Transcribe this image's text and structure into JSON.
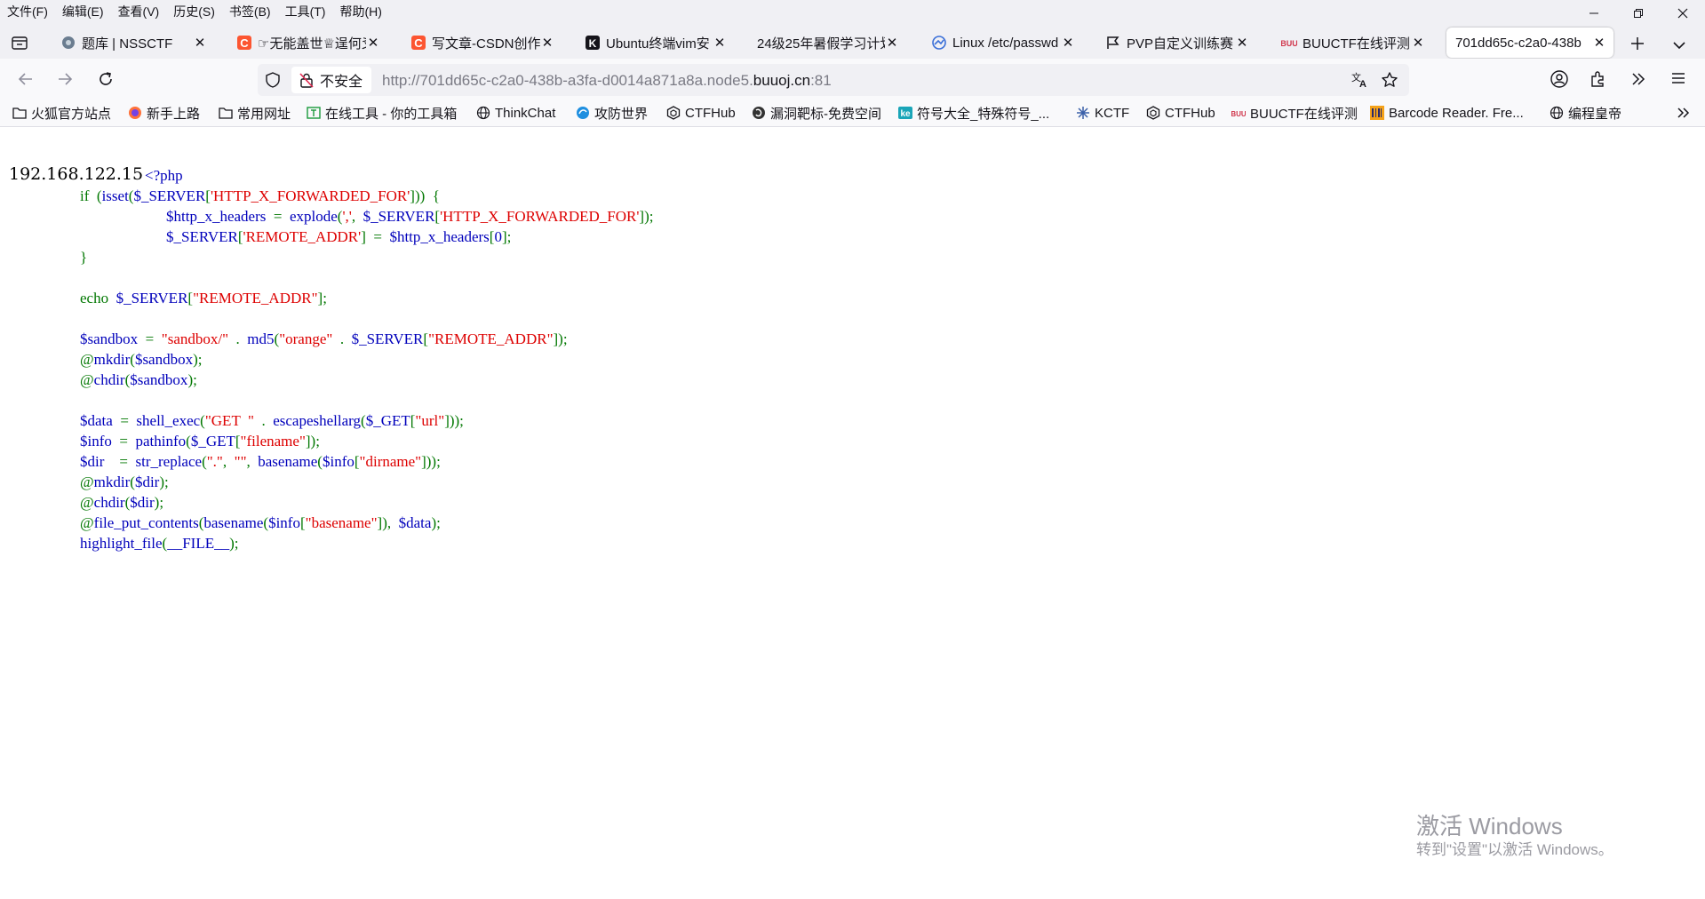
{
  "menu": [
    "文件(F)",
    "编辑(E)",
    "查看(V)",
    "历史(S)",
    "书签(B)",
    "工具(T)",
    "帮助(H)"
  ],
  "tabs": [
    {
      "title": "题库 | NSSCTF",
      "icon": "nssctf-icon"
    },
    {
      "title": "☞无能盖世♕逞何爻",
      "icon": "csdn-icon",
      "color": "#fc5531"
    },
    {
      "title": "写文章-CSDN创作",
      "icon": "csdn-icon",
      "color": "#fc5531"
    },
    {
      "title": "Ubuntu终端vim安",
      "icon": "k-icon"
    },
    {
      "title": "24级25年暑假学习计划",
      "icon": "none"
    },
    {
      "title": "Linux /etc/passwd",
      "icon": "globe-icon"
    },
    {
      "title": "PVP自定义训练赛",
      "icon": "flag-icon"
    },
    {
      "title": "BUUCTF在线评测",
      "icon": "buuctf-icon"
    },
    {
      "title": "701dd65c-c2a0-438b",
      "icon": "none",
      "active": true
    }
  ],
  "nav": {
    "insecure_label": "不安全",
    "url_prefix": "http://701dd65c-c2a0-438b-a3fa-d0014a871a8a.node5.",
    "url_host": "buuoj.cn",
    "url_suffix": ":81"
  },
  "bookmarks": [
    {
      "label": "火狐官方站点",
      "icon": "folder-icon"
    },
    {
      "label": "新手上路",
      "icon": "firefox-icon"
    },
    {
      "label": "常用网址",
      "icon": "folder-icon"
    },
    {
      "label": "在线工具 - 你的工具箱",
      "icon": "tools-icon"
    },
    {
      "label": "ThinkChat",
      "icon": "globe-icon"
    },
    {
      "label": "攻防世界",
      "icon": "adworld-icon"
    },
    {
      "label": "CTFHub",
      "icon": "ctfhub-icon"
    },
    {
      "label": "漏洞靶标-免费空间",
      "icon": "vulnbox-icon"
    },
    {
      "label": "符号大全_特殊符号_...",
      "icon": "ke-icon"
    },
    {
      "label": "KCTF",
      "icon": "kctf-icon"
    },
    {
      "label": "CTFHub",
      "icon": "ctfhub-icon"
    },
    {
      "label": "BUUCTF在线评测",
      "icon": "buuctf-icon"
    },
    {
      "label": "Barcode Reader. Fre...",
      "icon": "barcode-icon"
    },
    {
      "label": "编程皇帝",
      "icon": "globe-icon"
    }
  ],
  "page": {
    "ip": "192.168.122.15",
    "code_lines": [
      [
        {
          "t": "<?php",
          "c": "default"
        }
      ],
      [
        {
          "t": "    if  ",
          "c": "keyword"
        },
        {
          "t": "(",
          "c": "keyword"
        },
        {
          "t": "isset",
          "c": "default"
        },
        {
          "t": "(",
          "c": "keyword"
        },
        {
          "t": "$_SERVER",
          "c": "default"
        },
        {
          "t": "[",
          "c": "keyword"
        },
        {
          "t": "'HTTP_X_FORWARDED_FOR'",
          "c": "string"
        },
        {
          "t": "]))  {",
          "c": "keyword"
        }
      ],
      [
        {
          "t": "        $http_x_headers  ",
          "c": "default"
        },
        {
          "t": "=  ",
          "c": "keyword"
        },
        {
          "t": "explode",
          "c": "default"
        },
        {
          "t": "(",
          "c": "keyword"
        },
        {
          "t": "','",
          "c": "string"
        },
        {
          "t": ",  ",
          "c": "keyword"
        },
        {
          "t": "$_SERVER",
          "c": "default"
        },
        {
          "t": "[",
          "c": "keyword"
        },
        {
          "t": "'HTTP_X_FORWARDED_FOR'",
          "c": "string"
        },
        {
          "t": "]);",
          "c": "keyword"
        }
      ],
      [
        {
          "t": "        $_SERVER",
          "c": "default"
        },
        {
          "t": "[",
          "c": "keyword"
        },
        {
          "t": "'REMOTE_ADDR'",
          "c": "string"
        },
        {
          "t": "]  =  ",
          "c": "keyword"
        },
        {
          "t": "$http_x_headers",
          "c": "default"
        },
        {
          "t": "[",
          "c": "keyword"
        },
        {
          "t": "0",
          "c": "default"
        },
        {
          "t": "];",
          "c": "keyword"
        }
      ],
      [
        {
          "t": "    }",
          "c": "keyword"
        }
      ],
      [
        {
          "t": "",
          "c": "keyword"
        }
      ],
      [
        {
          "t": "    echo  ",
          "c": "keyword"
        },
        {
          "t": "$_SERVER",
          "c": "default"
        },
        {
          "t": "[",
          "c": "keyword"
        },
        {
          "t": "\"REMOTE_ADDR\"",
          "c": "string"
        },
        {
          "t": "];",
          "c": "keyword"
        }
      ],
      [
        {
          "t": "",
          "c": "keyword"
        }
      ],
      [
        {
          "t": "    $sandbox  ",
          "c": "default"
        },
        {
          "t": "=  ",
          "c": "keyword"
        },
        {
          "t": "\"sandbox/\"  ",
          "c": "string"
        },
        {
          "t": ".  ",
          "c": "keyword"
        },
        {
          "t": "md5",
          "c": "default"
        },
        {
          "t": "(",
          "c": "keyword"
        },
        {
          "t": "\"orange\"  ",
          "c": "string"
        },
        {
          "t": ".  ",
          "c": "keyword"
        },
        {
          "t": "$_SERVER",
          "c": "default"
        },
        {
          "t": "[",
          "c": "keyword"
        },
        {
          "t": "\"REMOTE_ADDR\"",
          "c": "string"
        },
        {
          "t": "]);",
          "c": "keyword"
        }
      ],
      [
        {
          "t": "    @",
          "c": "keyword"
        },
        {
          "t": "mkdir",
          "c": "default"
        },
        {
          "t": "(",
          "c": "keyword"
        },
        {
          "t": "$sandbox",
          "c": "default"
        },
        {
          "t": ");",
          "c": "keyword"
        }
      ],
      [
        {
          "t": "    @",
          "c": "keyword"
        },
        {
          "t": "chdir",
          "c": "default"
        },
        {
          "t": "(",
          "c": "keyword"
        },
        {
          "t": "$sandbox",
          "c": "default"
        },
        {
          "t": ");",
          "c": "keyword"
        }
      ],
      [
        {
          "t": "",
          "c": "keyword"
        }
      ],
      [
        {
          "t": "    $data  ",
          "c": "default"
        },
        {
          "t": "=  ",
          "c": "keyword"
        },
        {
          "t": "shell_exec",
          "c": "default"
        },
        {
          "t": "(",
          "c": "keyword"
        },
        {
          "t": "\"GET  \"  ",
          "c": "string"
        },
        {
          "t": ".  ",
          "c": "keyword"
        },
        {
          "t": "escapeshellarg",
          "c": "default"
        },
        {
          "t": "(",
          "c": "keyword"
        },
        {
          "t": "$_GET",
          "c": "default"
        },
        {
          "t": "[",
          "c": "keyword"
        },
        {
          "t": "\"url\"",
          "c": "string"
        },
        {
          "t": "]));",
          "c": "keyword"
        }
      ],
      [
        {
          "t": "    $info  ",
          "c": "default"
        },
        {
          "t": "=  ",
          "c": "keyword"
        },
        {
          "t": "pathinfo",
          "c": "default"
        },
        {
          "t": "(",
          "c": "keyword"
        },
        {
          "t": "$_GET",
          "c": "default"
        },
        {
          "t": "[",
          "c": "keyword"
        },
        {
          "t": "\"filename\"",
          "c": "string"
        },
        {
          "t": "]);",
          "c": "keyword"
        }
      ],
      [
        {
          "t": "    $dir    ",
          "c": "default"
        },
        {
          "t": "=  ",
          "c": "keyword"
        },
        {
          "t": "str_replace",
          "c": "default"
        },
        {
          "t": "(",
          "c": "keyword"
        },
        {
          "t": "\".\"",
          "c": "string"
        },
        {
          "t": ",  ",
          "c": "keyword"
        },
        {
          "t": "\"\"",
          "c": "string"
        },
        {
          "t": ",  ",
          "c": "keyword"
        },
        {
          "t": "basename",
          "c": "default"
        },
        {
          "t": "(",
          "c": "keyword"
        },
        {
          "t": "$info",
          "c": "default"
        },
        {
          "t": "[",
          "c": "keyword"
        },
        {
          "t": "\"dirname\"",
          "c": "string"
        },
        {
          "t": "]));",
          "c": "keyword"
        }
      ],
      [
        {
          "t": "    @",
          "c": "keyword"
        },
        {
          "t": "mkdir",
          "c": "default"
        },
        {
          "t": "(",
          "c": "keyword"
        },
        {
          "t": "$dir",
          "c": "default"
        },
        {
          "t": ");",
          "c": "keyword"
        }
      ],
      [
        {
          "t": "    @",
          "c": "keyword"
        },
        {
          "t": "chdir",
          "c": "default"
        },
        {
          "t": "(",
          "c": "keyword"
        },
        {
          "t": "$dir",
          "c": "default"
        },
        {
          "t": ");",
          "c": "keyword"
        }
      ],
      [
        {
          "t": "    @",
          "c": "keyword"
        },
        {
          "t": "file_put_contents",
          "c": "default"
        },
        {
          "t": "(",
          "c": "keyword"
        },
        {
          "t": "basename",
          "c": "default"
        },
        {
          "t": "(",
          "c": "keyword"
        },
        {
          "t": "$info",
          "c": "default"
        },
        {
          "t": "[",
          "c": "keyword"
        },
        {
          "t": "\"basename\"",
          "c": "string"
        },
        {
          "t": "]),  ",
          "c": "keyword"
        },
        {
          "t": "$data",
          "c": "default"
        },
        {
          "t": ");",
          "c": "keyword"
        }
      ],
      [
        {
          "t": "    highlight_file",
          "c": "default"
        },
        {
          "t": "(",
          "c": "keyword"
        },
        {
          "t": "__FILE__",
          "c": "default"
        },
        {
          "t": ");",
          "c": "keyword"
        }
      ]
    ]
  },
  "watermark": {
    "title": "激活 Windows",
    "subtitle": "转到\"设置\"以激活 Windows。"
  },
  "colors": {
    "php_default": "#0000bb",
    "php_keyword": "#007700",
    "php_string": "#dd0000",
    "chrome_bg": "#f0f0f4"
  }
}
